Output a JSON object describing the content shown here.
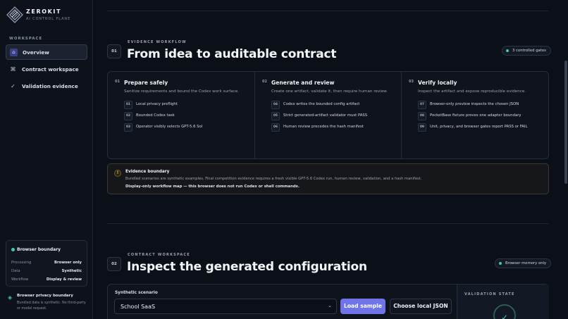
{
  "brand": {
    "name": "ZEROKIT",
    "subtitle": "AI CONTROL PLANE"
  },
  "sidebar": {
    "section_label": "WORKSPACE",
    "items": [
      {
        "label": "Overview",
        "icon": "home-icon",
        "active": true
      },
      {
        "label": "Contract workspace",
        "icon": "command-icon",
        "active": false
      },
      {
        "label": "Validation evidence",
        "icon": "check-icon",
        "active": false
      }
    ],
    "boundary": {
      "title": "Browser boundary",
      "rows": [
        {
          "key": "Processing",
          "value": "Browser only"
        },
        {
          "key": "Data",
          "value": "Synthetic"
        },
        {
          "key": "Workflow",
          "value": "Display & review"
        }
      ]
    },
    "privacy": {
      "title": "Browser privacy boundary",
      "text": "Bundled data is synthetic. No third-party or model request."
    }
  },
  "workflow_section": {
    "step": "01",
    "eyebrow": "EVIDENCE WORKFLOW",
    "title": "From idea to auditable contract",
    "pill": "3 controlled gates",
    "columns": [
      {
        "num": "01",
        "title": "Prepare safely",
        "desc": "Sanitize requirements and bound the Codex work surface.",
        "items": [
          {
            "num": "01",
            "text": "Local privacy preflight"
          },
          {
            "num": "02",
            "text": "Bounded Codex task"
          },
          {
            "num": "03",
            "text": "Operator visibly selects GPT-5.6 Sol"
          }
        ]
      },
      {
        "num": "02",
        "title": "Generate and review",
        "desc": "Create one artifact, validate it, then require human review.",
        "items": [
          {
            "num": "04",
            "text": "Codex writes the bounded config artifact"
          },
          {
            "num": "05",
            "text": "Strict generated-artifact validator must PASS"
          },
          {
            "num": "06",
            "text": "Human review precedes the hash manifest"
          }
        ]
      },
      {
        "num": "03",
        "title": "Verify locally",
        "desc": "Inspect the artifact and expose reproducible evidence.",
        "items": [
          {
            "num": "07",
            "text": "Browser-only preview inspects the chosen JSON"
          },
          {
            "num": "08",
            "text": "PocketBase fixture proves one adapter boundary"
          },
          {
            "num": "09",
            "text": "Unit, privacy, and browser gates report PASS or FAIL"
          }
        ]
      }
    ],
    "callout": {
      "icon": "!",
      "title": "Evidence boundary",
      "text": "Bundled scenarios are synthetic examples. Final competition evidence requires a fresh visible GPT-5.6 Codex run, human review, validation, and a hash manifest.",
      "strong": "Display-only workflow map — this browser does not run Codex or shell commands."
    }
  },
  "contract_section": {
    "step": "02",
    "eyebrow": "CONTRACT WORKSPACE",
    "title": "Inspect the generated configuration",
    "pill": "Browser memory only",
    "scenario_label": "Synthetic scenario",
    "scenario_value": "School SaaS",
    "load_button": "Load sample",
    "choose_button": "Choose local JSON",
    "validation_title": "VALIDATION STATE",
    "validation_icon": "✓"
  },
  "colors": {
    "accent": "#6f74e8",
    "teal": "#43c7b0",
    "warning": "#e1b94a",
    "background": "#0b0f17"
  }
}
